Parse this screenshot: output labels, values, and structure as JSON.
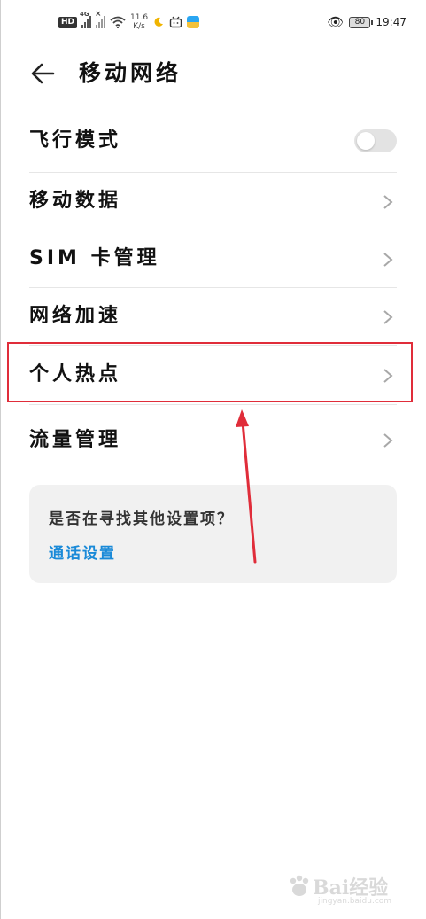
{
  "status_bar": {
    "hd_label": "HD",
    "signal1_type": "4G",
    "net_speed_value": "11.6",
    "net_speed_unit": "K/s",
    "battery_level": "80",
    "time": "19:47",
    "icons": [
      "hd-icon",
      "signal-4g-icon",
      "signal-no-sim-icon",
      "wifi-icon",
      "weather-icon",
      "bilibili-icon",
      "gallery-app-icon",
      "eye-comfort-icon",
      "battery-icon"
    ]
  },
  "header": {
    "title": "移动网络"
  },
  "settings": {
    "items": [
      {
        "label": "飞行模式",
        "control": "toggle",
        "toggle_on": false
      },
      {
        "label": "移动数据",
        "control": "chevron"
      },
      {
        "label": "SIM 卡管理",
        "control": "chevron"
      },
      {
        "label": "网络加速",
        "control": "chevron"
      },
      {
        "label": "个人热点",
        "control": "chevron",
        "highlighted": true
      },
      {
        "label": "流量管理",
        "control": "chevron"
      }
    ]
  },
  "suggestion": {
    "question": "是否在寻找其他设置项？",
    "link": "通话设置"
  },
  "colors": {
    "accent_link": "#1a8ad8",
    "highlight_red": "#e02d3a",
    "card_bg": "#f1f1f1"
  },
  "watermark": {
    "text": "Bai 经验",
    "sub": "jingyan.baidu.com"
  }
}
